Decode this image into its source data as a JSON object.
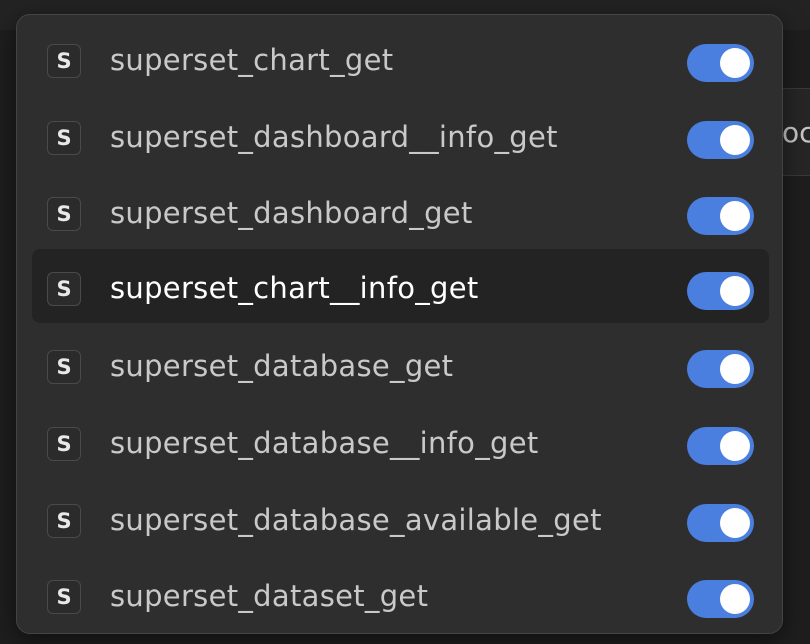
{
  "background": {
    "partial_text": "oc"
  },
  "menu": {
    "items": [
      {
        "badge": "S",
        "label": "superset_chart_get",
        "enabled": true
      },
      {
        "badge": "S",
        "label": "superset_dashboard__info_get",
        "enabled": true
      },
      {
        "badge": "S",
        "label": "superset_dashboard_get",
        "enabled": true
      },
      {
        "badge": "S",
        "label": "superset_chart__info_get",
        "enabled": true
      },
      {
        "badge": "S",
        "label": "superset_database_get",
        "enabled": true
      },
      {
        "badge": "S",
        "label": "superset_database__info_get",
        "enabled": true
      },
      {
        "badge": "S",
        "label": "superset_database_available_get",
        "enabled": true
      },
      {
        "badge": "S",
        "label": "superset_dataset_get",
        "enabled": true
      }
    ]
  },
  "colors": {
    "toggle_on": "#4a7fe0",
    "menu_bg": "#2e2e2e",
    "highlight_bg": "#232323"
  }
}
